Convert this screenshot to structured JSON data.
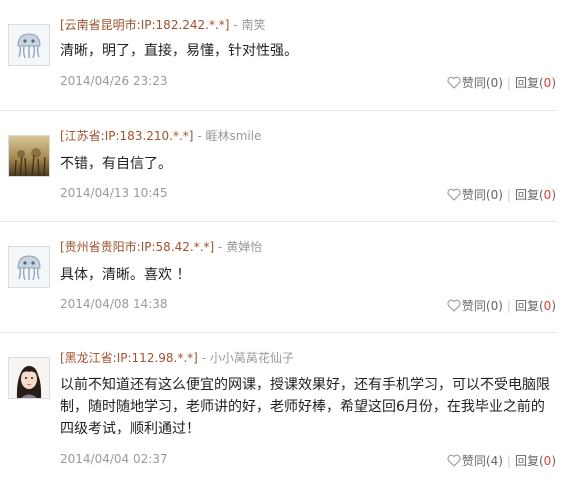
{
  "comments": [
    {
      "location": "[云南省昆明市:IP:182.242.*.*]",
      "separator": "-",
      "username": "南笑",
      "avatar": "jellyfish-avatar",
      "text": "清晰，明了，直接，易懂，针对性强。",
      "date": "2014/04/26 23:23",
      "like_label": "赞同",
      "like_count": "(0)",
      "reply_label": "回复",
      "reply_open": "(",
      "reply_count": "0",
      "reply_close": ")"
    },
    {
      "location": "[江苏省:IP:183.210.*.*]",
      "separator": "-",
      "username": "睚林smile",
      "avatar": "landscape-avatar",
      "text": "不错，有自信了。",
      "date": "2014/04/13 10:45",
      "like_label": "赞同",
      "like_count": "(0)",
      "reply_label": "回复",
      "reply_open": "(",
      "reply_count": "0",
      "reply_close": ")"
    },
    {
      "location": "[贵州省贵阳市:IP:58.42.*.*]",
      "separator": "-",
      "username": "黄婵怡",
      "avatar": "jellyfish-avatar",
      "text": "具体，清晰。喜欢 ！",
      "date": "2014/04/08 14:38",
      "like_label": "赞同",
      "like_count": "(0)",
      "reply_label": "回复",
      "reply_open": "(",
      "reply_count": "0",
      "reply_close": ")"
    },
    {
      "location": "[黑龙江省:IP:112.98.*.*]",
      "separator": "-",
      "username": "小小莴莴花仙子",
      "avatar": "girl-portrait-avatar",
      "text": "以前不知道还有这么便宜的网课，授课效果好，还有手机学习，可以不受电脑限制，随时随地学习，老师讲的好，老师好棒，希望这回6月份，在我毕业之前的四级考试，顺利通过！",
      "date": "2014/04/04 02:37",
      "like_label": "赞同",
      "like_count": "(4)",
      "reply_label": "回复",
      "reply_open": "(",
      "reply_count": "0",
      "reply_close": ")"
    }
  ]
}
